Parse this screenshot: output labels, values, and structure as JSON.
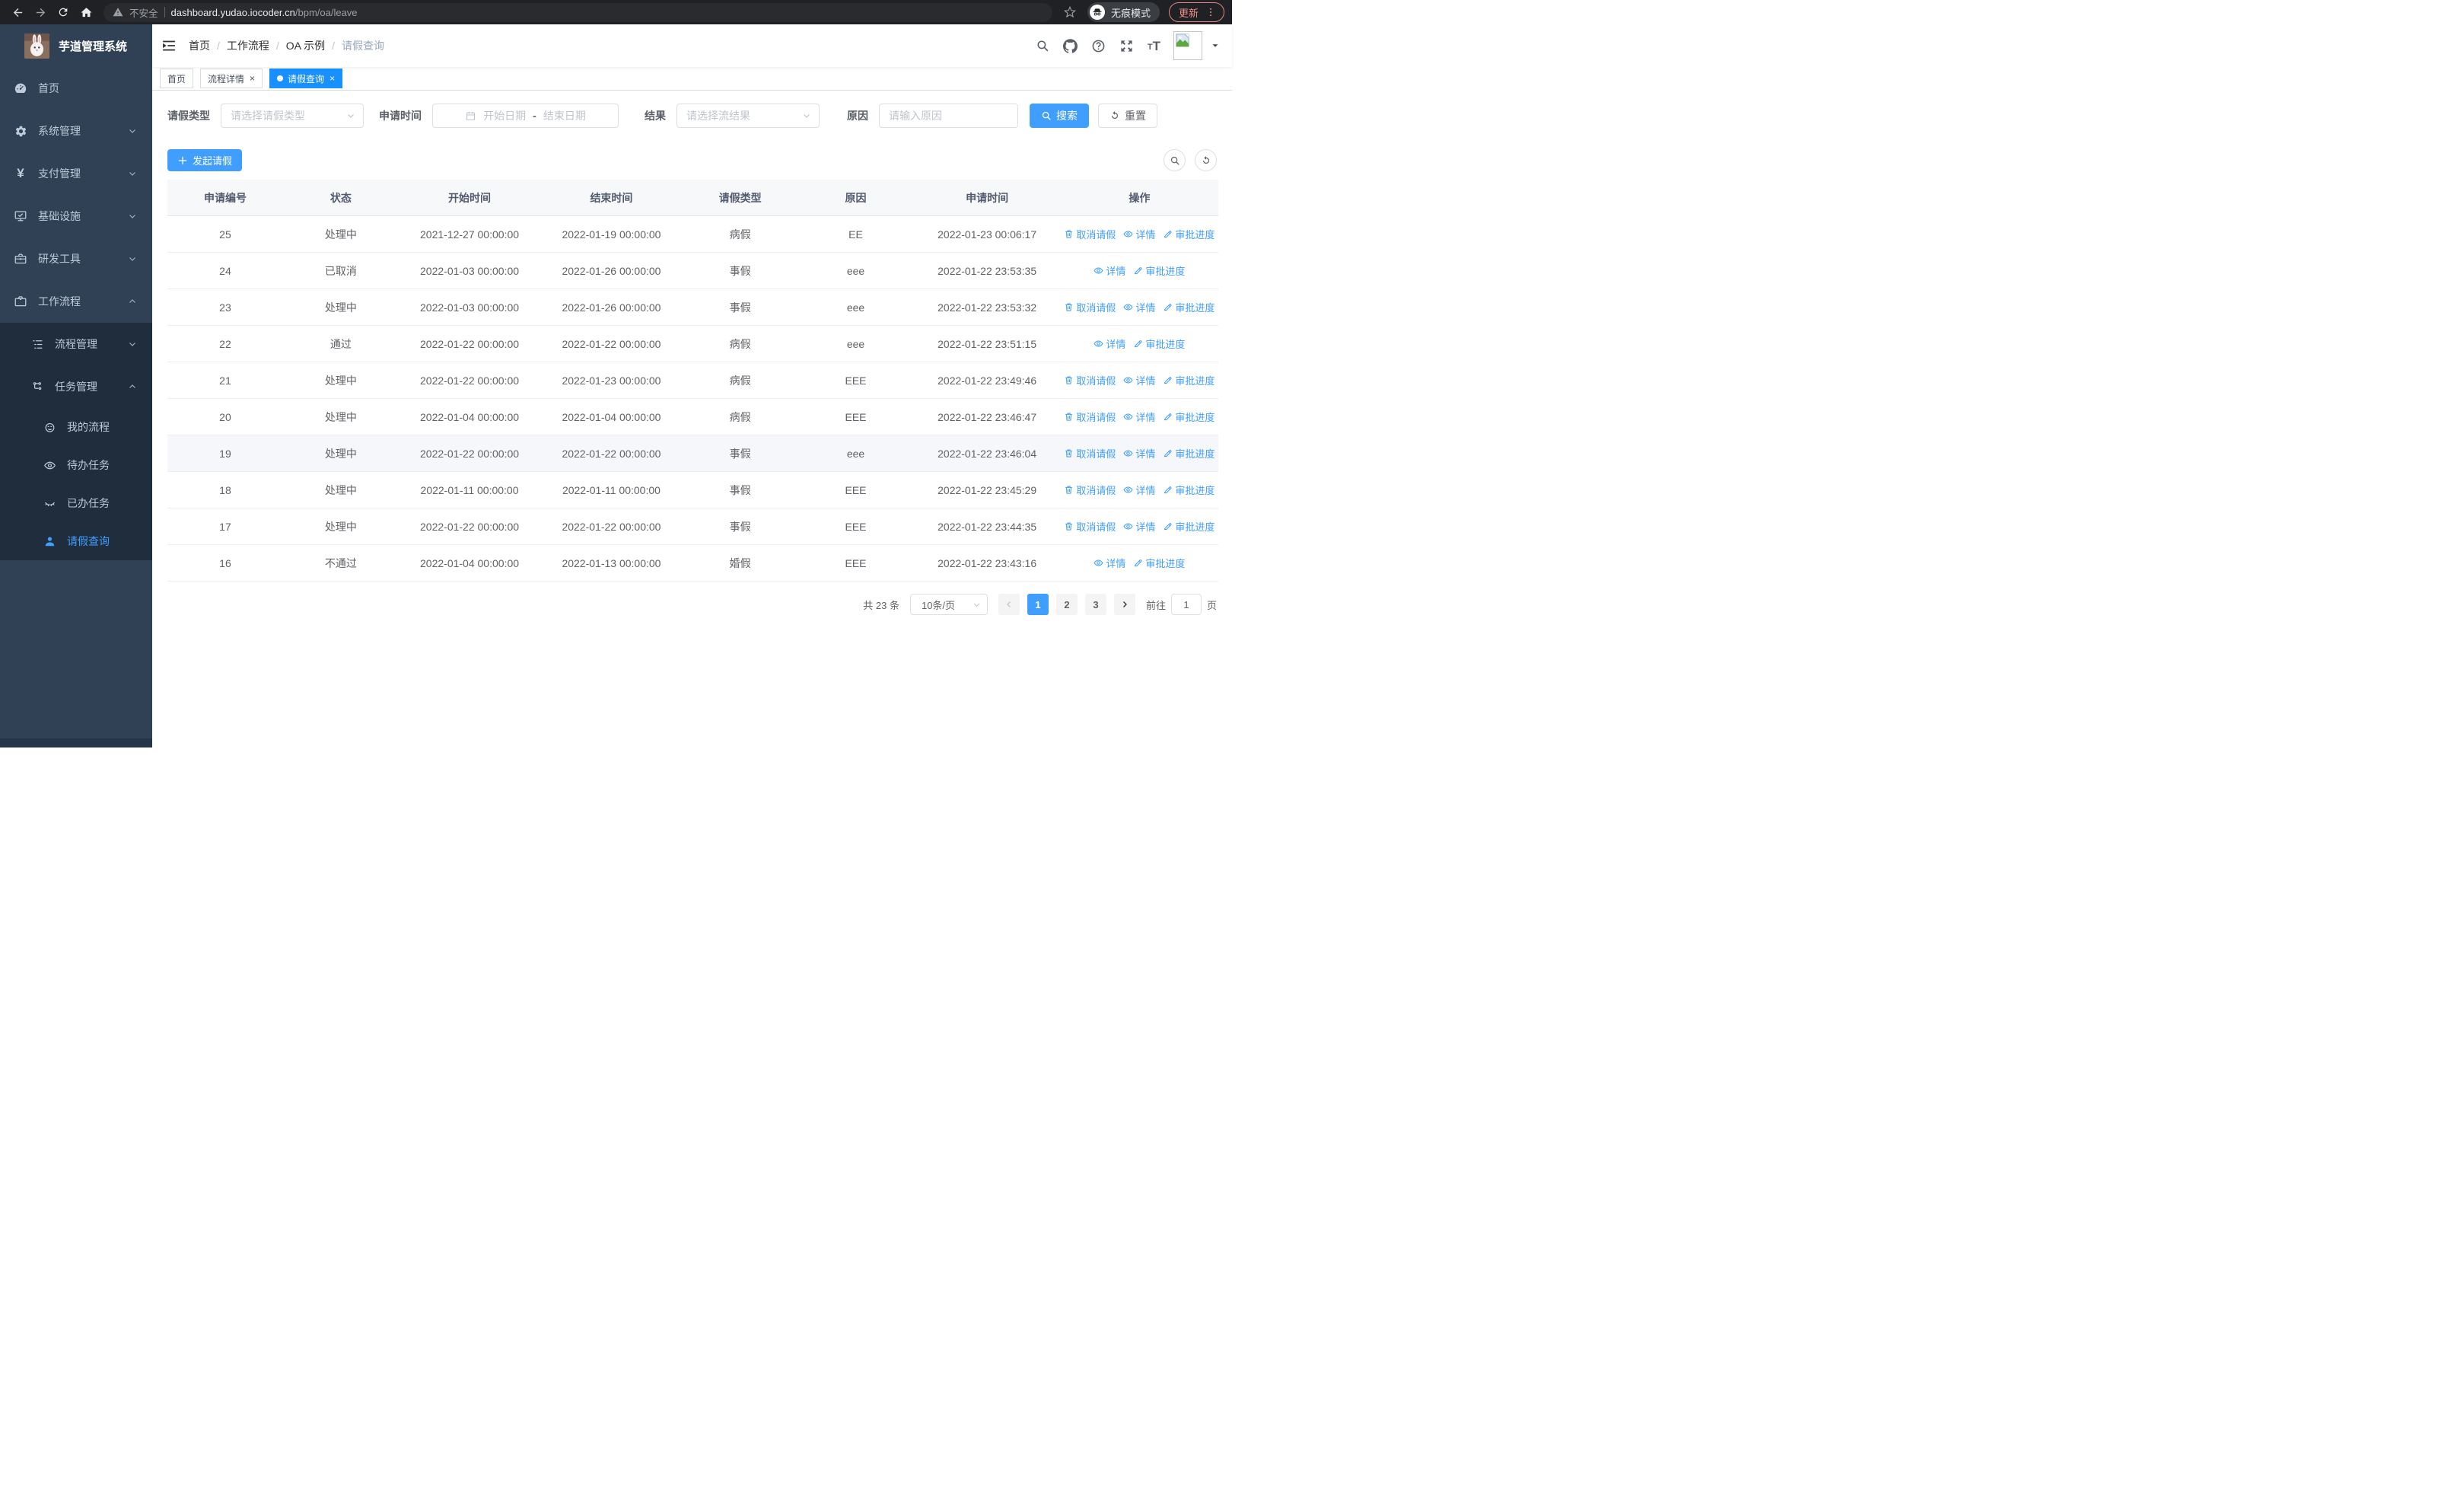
{
  "browser": {
    "security_warning": "不安全",
    "url_host": "dashboard.yudao.iocoder.cn",
    "url_path": "/bpm/oa/leave",
    "incognito_label": "无痕模式",
    "update_label": "更新"
  },
  "sidebar": {
    "app_title": "芋道管理系统",
    "items": [
      {
        "label": "首页",
        "icon": "dashboard-icon"
      },
      {
        "label": "系统管理",
        "icon": "gear-icon",
        "state": "collapsed"
      },
      {
        "label": "支付管理",
        "icon": "yen-icon",
        "state": "collapsed"
      },
      {
        "label": "基础设施",
        "icon": "monitor-check-icon",
        "state": "collapsed"
      },
      {
        "label": "研发工具",
        "icon": "toolbox-icon",
        "state": "collapsed"
      },
      {
        "label": "工作流程",
        "icon": "briefcase-icon",
        "state": "expanded",
        "children": [
          {
            "label": "流程管理",
            "icon": "list-tree-icon",
            "state": "collapsed"
          },
          {
            "label": "任务管理",
            "icon": "flow-icon",
            "state": "expanded",
            "children": [
              {
                "label": "我的流程",
                "icon": "face-icon"
              },
              {
                "label": "待办任务",
                "icon": "eye-open-icon"
              },
              {
                "label": "已办任务",
                "icon": "eye-closed-icon"
              },
              {
                "label": "请假查询",
                "icon": "user-icon",
                "active": true
              }
            ]
          }
        ]
      }
    ]
  },
  "header": {
    "breadcrumb": [
      "首页",
      "工作流程",
      "OA 示例",
      "请假查询"
    ]
  },
  "tabs": [
    {
      "label": "首页",
      "closable": false,
      "active": false
    },
    {
      "label": "流程详情",
      "closable": true,
      "active": false
    },
    {
      "label": "请假查询",
      "closable": true,
      "active": true
    }
  ],
  "filters": {
    "leave_type_label": "请假类型",
    "leave_type_placeholder": "请选择请假类型",
    "apply_time_label": "申请时间",
    "date_start_placeholder": "开始日期",
    "date_separator": "-",
    "date_end_placeholder": "结束日期",
    "result_label": "结果",
    "result_placeholder": "请选择流结果",
    "reason_label": "原因",
    "reason_placeholder": "请输入原因",
    "search_label": "搜索",
    "reset_label": "重置"
  },
  "toolbar": {
    "create_label": "发起请假"
  },
  "table": {
    "columns": [
      "申请编号",
      "状态",
      "开始时间",
      "结束时间",
      "请假类型",
      "原因",
      "申请时间",
      "操作"
    ],
    "action_defs": {
      "cancel": {
        "label": "取消请假",
        "icon": "trash-icon"
      },
      "detail": {
        "label": "详情",
        "icon": "eye-icon"
      },
      "progress": {
        "label": "审批进度",
        "icon": "edit-icon"
      }
    },
    "rows": [
      {
        "id": "25",
        "status": "处理中",
        "start": "2021-12-27 00:00:00",
        "end": "2022-01-19 00:00:00",
        "type": "病假",
        "reason": "EE",
        "apply_time": "2022-01-23 00:06:17",
        "actions": [
          "cancel",
          "detail",
          "progress"
        ],
        "highlight": false
      },
      {
        "id": "24",
        "status": "已取消",
        "start": "2022-01-03 00:00:00",
        "end": "2022-01-26 00:00:00",
        "type": "事假",
        "reason": "eee",
        "apply_time": "2022-01-22 23:53:35",
        "actions": [
          "detail",
          "progress"
        ],
        "highlight": false
      },
      {
        "id": "23",
        "status": "处理中",
        "start": "2022-01-03 00:00:00",
        "end": "2022-01-26 00:00:00",
        "type": "事假",
        "reason": "eee",
        "apply_time": "2022-01-22 23:53:32",
        "actions": [
          "cancel",
          "detail",
          "progress"
        ],
        "highlight": false
      },
      {
        "id": "22",
        "status": "通过",
        "start": "2022-01-22 00:00:00",
        "end": "2022-01-22 00:00:00",
        "type": "病假",
        "reason": "eee",
        "apply_time": "2022-01-22 23:51:15",
        "actions": [
          "detail",
          "progress"
        ],
        "highlight": false
      },
      {
        "id": "21",
        "status": "处理中",
        "start": "2022-01-22 00:00:00",
        "end": "2022-01-23 00:00:00",
        "type": "病假",
        "reason": "EEE",
        "apply_time": "2022-01-22 23:49:46",
        "actions": [
          "cancel",
          "detail",
          "progress"
        ],
        "highlight": false
      },
      {
        "id": "20",
        "status": "处理中",
        "start": "2022-01-04 00:00:00",
        "end": "2022-01-04 00:00:00",
        "type": "病假",
        "reason": "EEE",
        "apply_time": "2022-01-22 23:46:47",
        "actions": [
          "cancel",
          "detail",
          "progress"
        ],
        "highlight": false
      },
      {
        "id": "19",
        "status": "处理中",
        "start": "2022-01-22 00:00:00",
        "end": "2022-01-22 00:00:00",
        "type": "事假",
        "reason": "eee",
        "apply_time": "2022-01-22 23:46:04",
        "actions": [
          "cancel",
          "detail",
          "progress"
        ],
        "highlight": true
      },
      {
        "id": "18",
        "status": "处理中",
        "start": "2022-01-11 00:00:00",
        "end": "2022-01-11 00:00:00",
        "type": "事假",
        "reason": "EEE",
        "apply_time": "2022-01-22 23:45:29",
        "actions": [
          "cancel",
          "detail",
          "progress"
        ],
        "highlight": false
      },
      {
        "id": "17",
        "status": "处理中",
        "start": "2022-01-22 00:00:00",
        "end": "2022-01-22 00:00:00",
        "type": "事假",
        "reason": "EEE",
        "apply_time": "2022-01-22 23:44:35",
        "actions": [
          "cancel",
          "detail",
          "progress"
        ],
        "highlight": false
      },
      {
        "id": "16",
        "status": "不通过",
        "start": "2022-01-04 00:00:00",
        "end": "2022-01-13 00:00:00",
        "type": "婚假",
        "reason": "EEE",
        "apply_time": "2022-01-22 23:43:16",
        "actions": [
          "detail",
          "progress"
        ],
        "highlight": false
      }
    ]
  },
  "pagination": {
    "total_text": "共 23 条",
    "page_size": "10条/页",
    "pages": [
      "1",
      "2",
      "3"
    ],
    "active_page": "1",
    "goto_label": "前往",
    "goto_value": "1",
    "page_unit": "页"
  },
  "colors": {
    "primary": "#409EFF",
    "tab_active": "#1890ff",
    "sidebar_bg": "#304156",
    "submenu_bg": "#1f2d3d"
  }
}
